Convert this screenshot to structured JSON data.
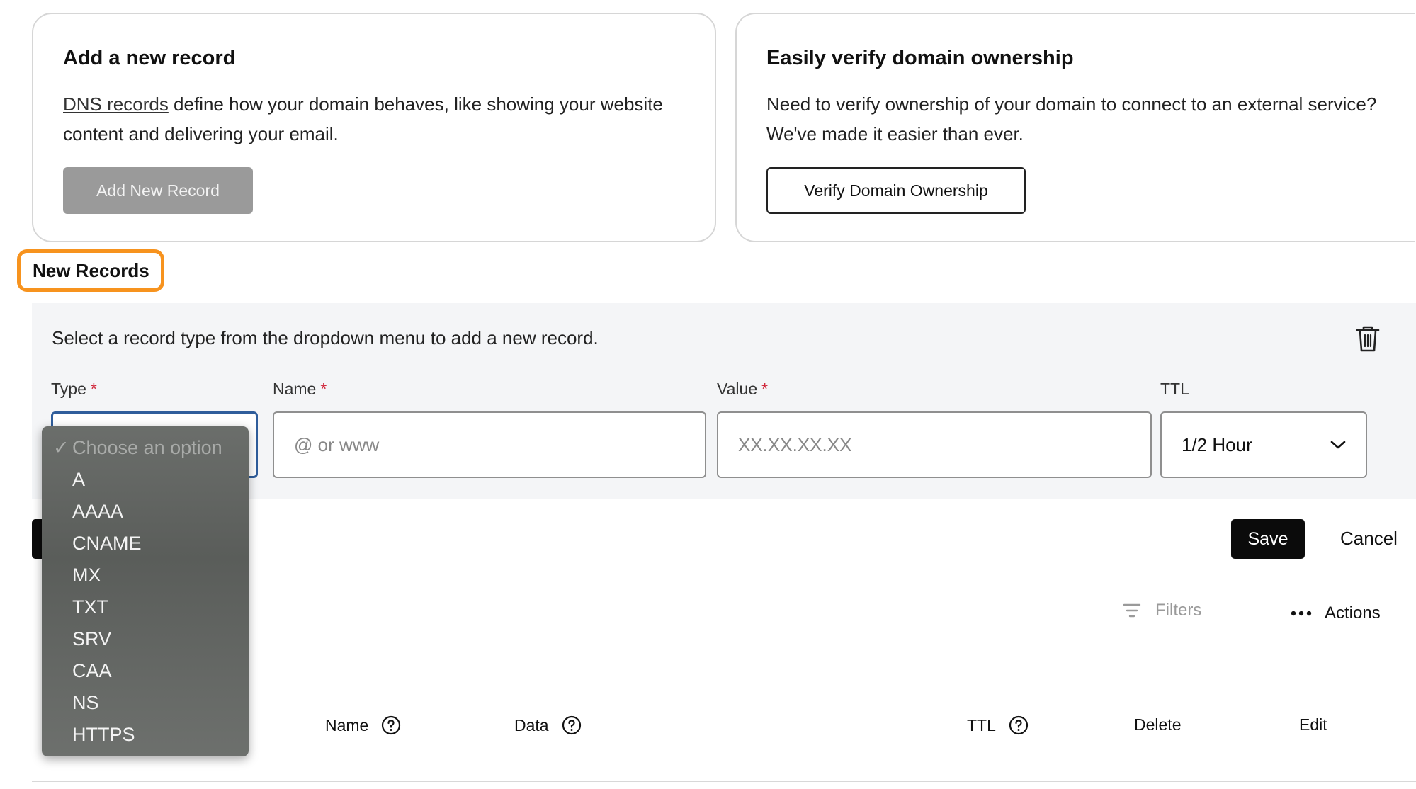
{
  "add_card": {
    "title": "Add a new record",
    "link_text": "DNS records",
    "description_rest": " define how your domain behaves, like showing your website content and delivering your email.",
    "button": "Add New Record"
  },
  "verify_card": {
    "title": "Easily verify domain ownership",
    "description": "Need to verify ownership of your domain to connect to an external service? We've made it easier than ever.",
    "button": "Verify Domain Ownership"
  },
  "section": {
    "title": "New Records"
  },
  "new_record": {
    "hint": "Select a record type from the dropdown menu to add a new record.",
    "fields": {
      "type": {
        "label": "Type",
        "required": "*"
      },
      "name": {
        "label": "Name",
        "required": "*",
        "placeholder": "@ or www"
      },
      "value": {
        "label": "Value",
        "required": "*",
        "placeholder": "XX.XX.XX.XX"
      },
      "ttl": {
        "label": "TTL",
        "value": "1/2 Hour"
      }
    },
    "save": "Save",
    "cancel": "Cancel"
  },
  "dropdown": {
    "placeholder": "Choose an option",
    "check": "✓",
    "options": [
      "A",
      "AAAA",
      "CNAME",
      "MX",
      "TXT",
      "SRV",
      "CAA",
      "NS",
      "HTTPS"
    ]
  },
  "toolbar": {
    "filters": "Filters",
    "actions": "Actions"
  },
  "table": {
    "columns": {
      "name": "Name",
      "data": "Data",
      "ttl": "TTL",
      "delete": "Delete",
      "edit": "Edit"
    }
  },
  "colors": {
    "accent_highlight": "#f7931e",
    "required": "#d0263a",
    "primary_button": "#0b0b0b",
    "focus_border": "#2f5d9b"
  }
}
